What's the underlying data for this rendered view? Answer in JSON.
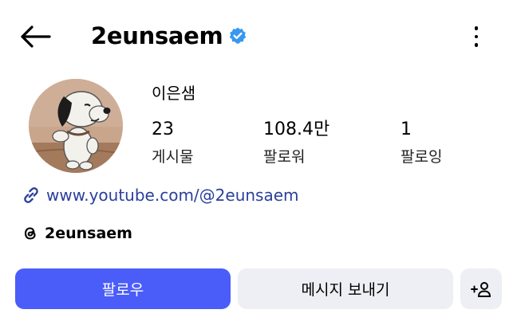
{
  "header": {
    "username": "2eunsaem",
    "back_icon": "arrow-left-icon",
    "verified_icon": "verified-badge-icon",
    "more_icon": "more-vertical-icon",
    "verified_color": "#3897f0"
  },
  "profile": {
    "display_name": "이은샘",
    "stats": [
      {
        "value": "23",
        "label": "게시물"
      },
      {
        "value": "108.4만",
        "label": "팔로워"
      },
      {
        "value": "1",
        "label": "팔로잉"
      }
    ],
    "link": {
      "icon": "link-icon",
      "text": "www.youtube.com/@2eunsaem",
      "color": "#2b3f9c"
    },
    "threads": {
      "icon": "threads-icon",
      "handle": "2eunsaem"
    }
  },
  "actions": {
    "follow_label": "팔로우",
    "message_label": "메시지 보내기",
    "add_person_icon": "add-person-icon",
    "follow_color": "#4a5df9",
    "secondary_color": "#eeeff4"
  }
}
